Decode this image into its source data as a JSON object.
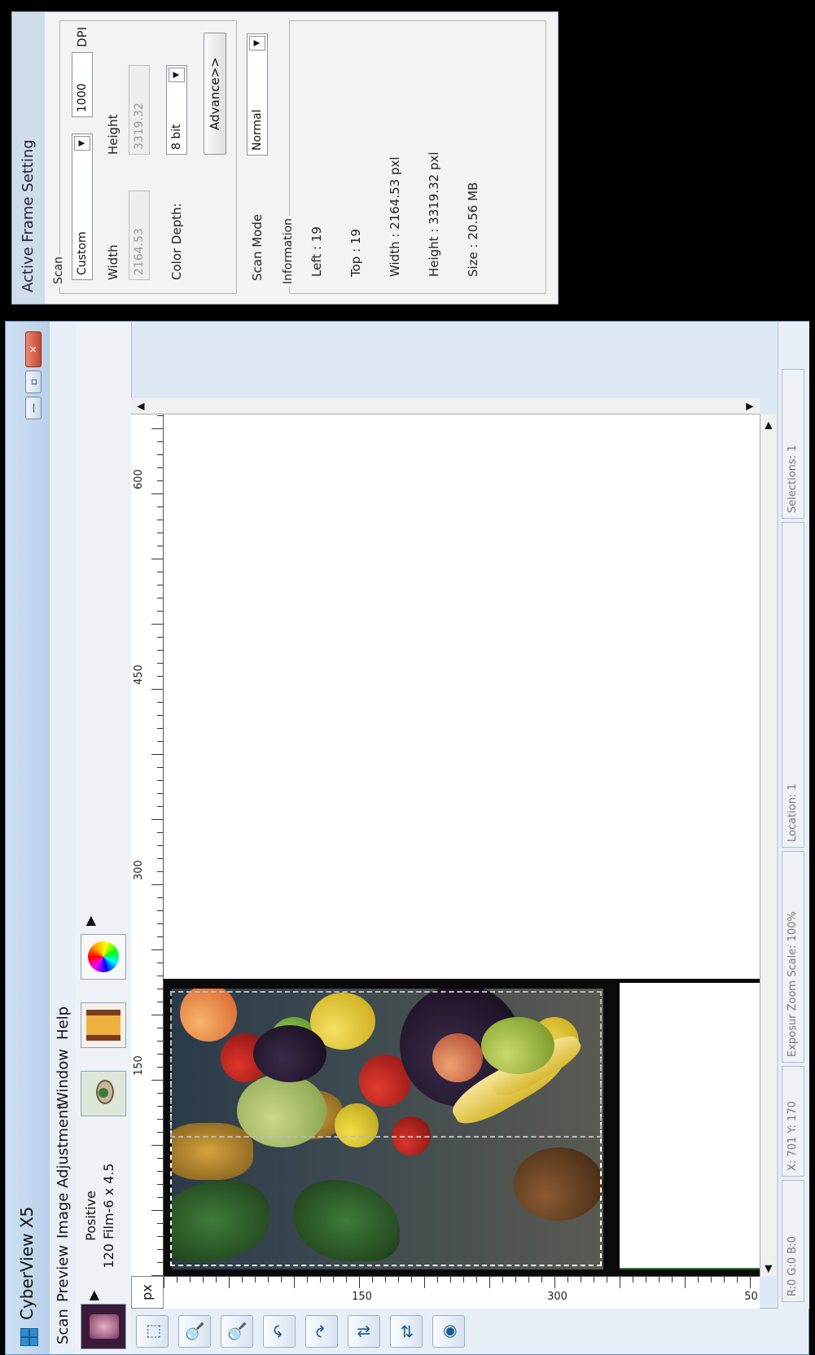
{
  "window": {
    "title": "CyberView X5",
    "controls": {
      "minimize": "—",
      "maximize": "▫",
      "close": "✕"
    }
  },
  "menu": [
    {
      "id": "scan",
      "label": "Scan"
    },
    {
      "id": "preview",
      "label": "Preview"
    },
    {
      "id": "image-adjustment",
      "label": "Image Adjustment"
    },
    {
      "id": "window",
      "label": "Window"
    },
    {
      "id": "help",
      "label": "Help"
    }
  ],
  "toolbar": {
    "film_type": "Positive",
    "film_format": "120 Film-6 x 4.5",
    "arrow_glyph": "▶",
    "icons": [
      "film-thumbnail-icon",
      "eye-icon",
      "film-strip-icon",
      "color-wheel-icon"
    ]
  },
  "tools": [
    {
      "name": "select-rectangle-tool-icon",
      "glyph": "⬚"
    },
    {
      "name": "zoom-in-tool-icon",
      "glyph": "🔍"
    },
    {
      "name": "zoom-out-tool-icon",
      "glyph": "🔍"
    },
    {
      "name": "rotate-left-tool-icon",
      "glyph": "↶"
    },
    {
      "name": "rotate-right-tool-icon",
      "glyph": "↷"
    },
    {
      "name": "flip-vertical-tool-icon",
      "glyph": "⇅"
    },
    {
      "name": "flip-horizontal-tool-icon",
      "glyph": "⇄"
    },
    {
      "name": "color-tool-icon",
      "glyph": "◉"
    }
  ],
  "ruler": {
    "unit": "px",
    "top_labels": [
      "150",
      "300",
      "450",
      "600"
    ],
    "left_labels": [
      "150",
      "300",
      "50"
    ]
  },
  "status": {
    "rgb": "R:0 G:0 B:0",
    "coords": "X: 701 Y: 170",
    "exposure_zoom": "Exposur Zoom Scale: 100%",
    "location": "Location: 1",
    "selections": "Selections: 1"
  },
  "panel": {
    "title": "Active Frame Setting",
    "scan_group": "Scan",
    "scan_preset": "Custom",
    "dpi_value": "1000",
    "dpi_label": "DPI",
    "width_label": "Width",
    "height_label": "Height",
    "width_value": "2164.53",
    "height_value": "3319.32",
    "color_depth_label": "Color Depth:",
    "color_depth_value": "8 bit",
    "advance_button": "Advance>>",
    "scan_mode_label": "Scan Mode",
    "scan_mode_value": "Normal",
    "info_group": "Information",
    "info": {
      "left": "Left : 19",
      "top": "Top : 19",
      "width": "Width : 2164.53 pxl",
      "height": "Height : 3319.32 pxl",
      "size": "Size : 20.56 MB"
    }
  },
  "colors": {
    "titlebar": "#b9d0ea",
    "panel_bg": "#f3f3f3",
    "close_button": "#c5472e"
  }
}
